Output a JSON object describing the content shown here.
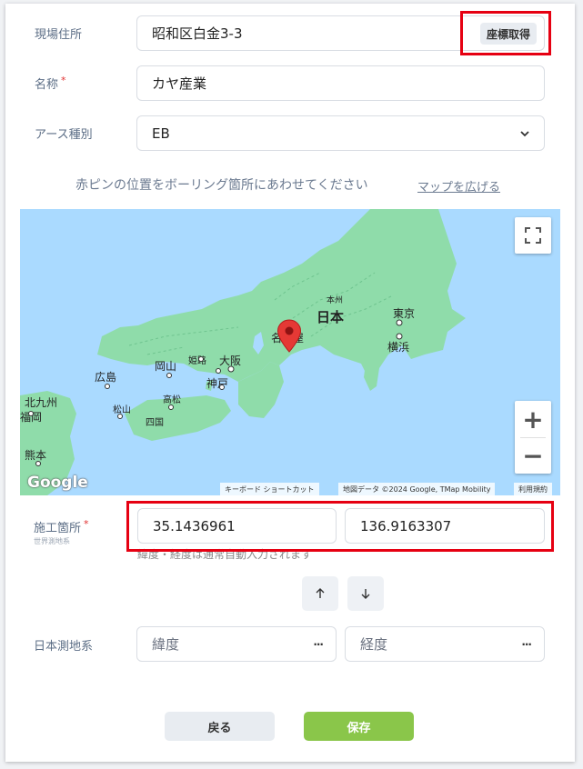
{
  "site": {
    "label": "現場住所",
    "value": "昭和区白金3-3",
    "geo_button": "座標取得"
  },
  "name": {
    "label": "名称",
    "required_mark": "*",
    "value": "カヤ産業"
  },
  "earth_type": {
    "label": "アース種別",
    "selected": "EB"
  },
  "map_hint": {
    "text": "赤ピンの位置をボーリング箇所にあわせてください",
    "expand_link": "マップを広げる"
  },
  "map": {
    "labels": {
      "japan": "日本",
      "tokyo": "東京",
      "yokohama": "横浜",
      "nagoya": "名古屋",
      "osaka": "大阪",
      "kobe": "神戸",
      "himeji": "姫路",
      "okayama": "岡山",
      "hiroshima": "広島",
      "takamatsu": "高松",
      "matsuyama": "松山",
      "shikoku": "四国",
      "kitakyushu": "北九州",
      "fukuoka": "福岡",
      "kumamoto": "熊本",
      "honshu": "本州"
    },
    "attribution": {
      "shortcuts": "キーボード ショートカット",
      "data": "地図データ ©2024 Google, TMap Mobility",
      "terms": "利用規約"
    },
    "logo": "Google",
    "zoom_in": "+",
    "zoom_out": "−"
  },
  "construction": {
    "label": "施工箇所",
    "required_mark": "*",
    "sublabel": "世界測地系",
    "lat": "35.1436961",
    "lng": "136.9163307",
    "note": "緯度・経度は通常自動入力されます"
  },
  "japan_datum": {
    "label": "日本測地系",
    "lat_placeholder": "緯度",
    "lng_placeholder": "経度",
    "more": "···"
  },
  "actions": {
    "back": "戻る",
    "save": "保存"
  },
  "colors": {
    "accent_red": "#e60012",
    "save_green": "#8ac64a",
    "land": "#8fdcaa",
    "water": "#aadaff"
  }
}
